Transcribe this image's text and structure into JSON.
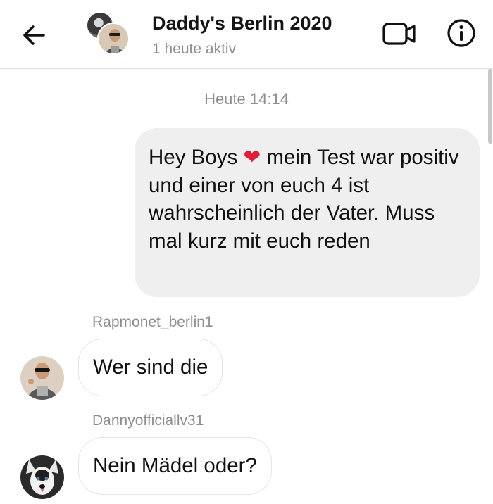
{
  "header": {
    "title": "Daddy's Berlin 2020",
    "subtitle": "1 heute aktiv",
    "icons": [
      "back-arrow-icon",
      "group-avatar",
      "video-call-icon",
      "info-icon"
    ]
  },
  "thread": {
    "timestamp": "Heute 14:14",
    "outgoing": {
      "text_before_emoji": "Hey Boys ",
      "emoji": "❤",
      "text_after_emoji": " mein Test war positiv und einer von euch 4 ist wahrscheinlich der Vater. Muss mal kurz mit euch reden"
    },
    "incoming": [
      {
        "sender": "Rapmonet_berlin1",
        "text": "Wer sind die"
      },
      {
        "sender": "Dannyofficiallv31",
        "text": "Nein Mädel oder?"
      }
    ]
  },
  "colors": {
    "outgoing_bubble": "#efefef",
    "incoming_bubble_border": "#e4e4e4",
    "muted_text": "#8e8e8e",
    "heart": "#e0203a"
  }
}
